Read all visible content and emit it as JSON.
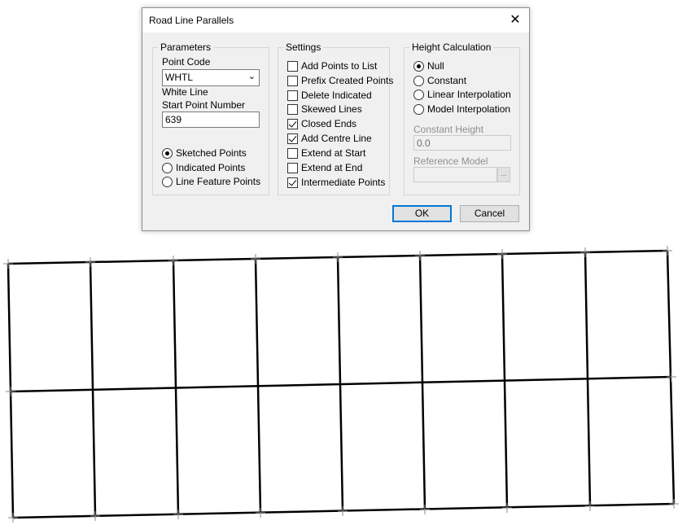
{
  "dialog": {
    "title": "Road Line Parallels",
    "close_glyph": "✕",
    "ok_label": "OK",
    "cancel_label": "Cancel"
  },
  "parameters": {
    "group_label": "Parameters",
    "point_code_label": "Point Code",
    "point_code_value": "WHTL",
    "point_code_description": "White Line",
    "start_point_label": "Start Point Number",
    "start_point_value": "639",
    "radios": [
      {
        "label": "Sketched Points",
        "checked": true
      },
      {
        "label": "Indicated Points",
        "checked": false
      },
      {
        "label": "Line Feature Points",
        "checked": false
      }
    ]
  },
  "settings": {
    "group_label": "Settings",
    "items": [
      {
        "label": "Add Points to List",
        "checked": false
      },
      {
        "label": "Prefix Created Points",
        "checked": false
      },
      {
        "label": "Delete Indicated",
        "checked": false
      },
      {
        "label": "Skewed Lines",
        "checked": false
      },
      {
        "label": "Closed Ends",
        "checked": true
      },
      {
        "label": "Add Centre Line",
        "checked": true
      },
      {
        "label": "Extend at Start",
        "checked": false
      },
      {
        "label": "Extend at End",
        "checked": false
      },
      {
        "label": "Intermediate Points",
        "checked": true
      }
    ]
  },
  "height": {
    "group_label": "Height Calculation",
    "radios": [
      {
        "label": "Null",
        "checked": true
      },
      {
        "label": "Constant",
        "checked": false
      },
      {
        "label": "Linear Interpolation",
        "checked": false
      },
      {
        "label": "Model Interpolation",
        "checked": false
      }
    ],
    "constant_height_label": "Constant Height",
    "constant_height_value": "0.0",
    "reference_model_label": "Reference Model",
    "reference_model_value": "",
    "browse_glyph": "..."
  },
  "canvas": {
    "line_color": "#000000"
  }
}
